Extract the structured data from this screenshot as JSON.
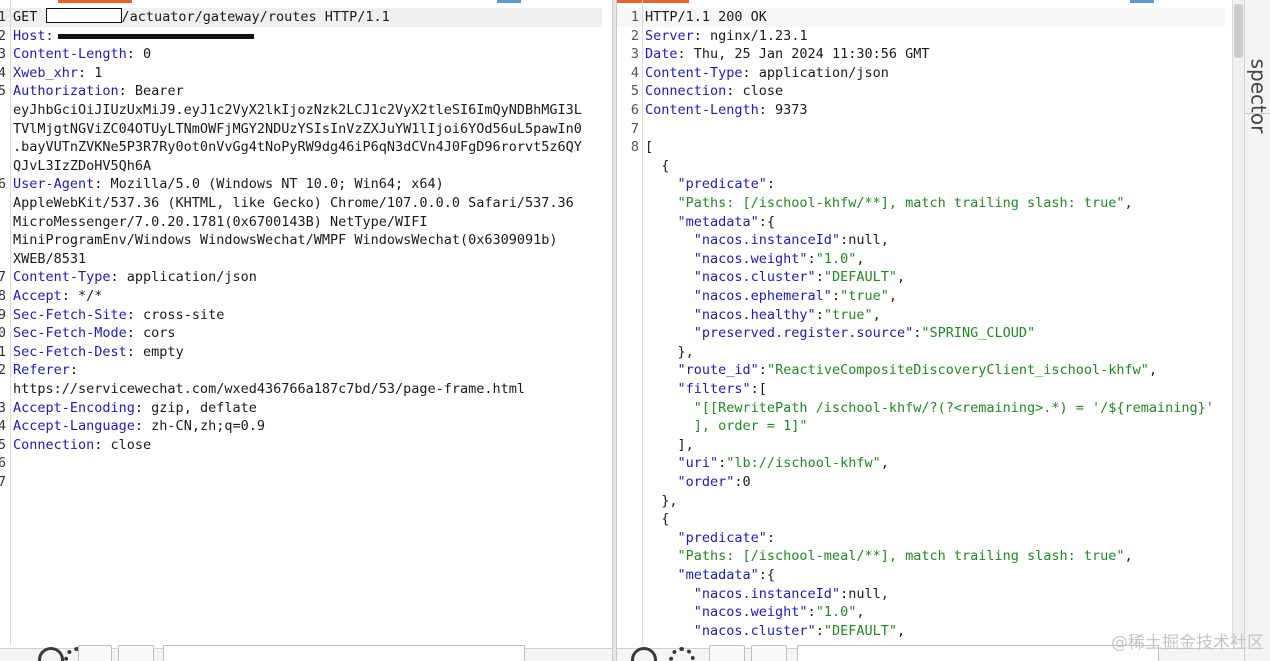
{
  "request": {
    "lines": [
      {
        "n": "1",
        "parts": [
          {
            "t": "GET ",
            "c": "plain"
          },
          {
            "redact": "box"
          },
          {
            "t": "/actuator/gateway/routes HTTP/1.1",
            "c": "plain"
          }
        ]
      },
      {
        "n": "2",
        "parts": [
          {
            "t": "Host:",
            "c": "hdr"
          },
          {
            "redact": "bar"
          }
        ]
      },
      {
        "n": "3",
        "parts": [
          {
            "t": "Content-Length",
            "c": "hdr"
          },
          {
            "t": ": 0",
            "c": "plain"
          }
        ]
      },
      {
        "n": "4",
        "parts": [
          {
            "t": "Xweb_xhr",
            "c": "hdr"
          },
          {
            "t": ": 1",
            "c": "plain"
          }
        ]
      },
      {
        "n": "5",
        "parts": [
          {
            "t": "Authorization",
            "c": "hdr"
          },
          {
            "t": ": Bearer",
            "c": "plain"
          }
        ]
      },
      {
        "n": "",
        "parts": [
          {
            "t": "eyJhbGciOiJIUzUxMiJ9.eyJ1c2VyX2lkIjozNzk2LCJ1c2VyX2tleSI6ImQyNDBhMGI3L",
            "c": "plain"
          }
        ]
      },
      {
        "n": "",
        "parts": [
          {
            "t": "TVlMjgtNGViZC04OTUyLTNmOWFjMGY2NDUzYSIsInVzZXJuYW1lIjoi6YOd56uL5pawIn0",
            "c": "plain"
          }
        ]
      },
      {
        "n": "",
        "parts": [
          {
            "t": ".bayVUTnZVKNe5P3R7Ry0ot0nVvGg4tNoPyRW9dg46iP6qN3dCVn4J0FgD96rorvt5z6QY",
            "c": "plain"
          }
        ]
      },
      {
        "n": "",
        "parts": [
          {
            "t": "QJvL3IzZDoHV5Qh6A",
            "c": "plain"
          }
        ]
      },
      {
        "n": "6",
        "parts": [
          {
            "t": "User-Agent",
            "c": "hdr"
          },
          {
            "t": ": Mozilla/5.0 (Windows NT 10.0; Win64; x64)",
            "c": "plain"
          }
        ]
      },
      {
        "n": "",
        "parts": [
          {
            "t": "AppleWebKit/537.36 (KHTML, like Gecko) Chrome/107.0.0.0 Safari/537.36",
            "c": "plain"
          }
        ]
      },
      {
        "n": "",
        "parts": [
          {
            "t": "MicroMessenger/7.0.20.1781(0x6700143B) NetType/WIFI",
            "c": "plain"
          }
        ]
      },
      {
        "n": "",
        "parts": [
          {
            "t": "MiniProgramEnv/Windows WindowsWechat/WMPF WindowsWechat(0x6309091b)",
            "c": "plain"
          }
        ]
      },
      {
        "n": "",
        "parts": [
          {
            "t": "XWEB/8531",
            "c": "plain"
          }
        ]
      },
      {
        "n": "7",
        "parts": [
          {
            "t": "Content-Type",
            "c": "hdr"
          },
          {
            "t": ": application/json",
            "c": "plain"
          }
        ]
      },
      {
        "n": "8",
        "parts": [
          {
            "t": "Accept",
            "c": "hdr"
          },
          {
            "t": ": */*",
            "c": "plain"
          }
        ]
      },
      {
        "n": "9",
        "parts": [
          {
            "t": "Sec-Fetch-Site",
            "c": "hdr"
          },
          {
            "t": ": cross-site",
            "c": "plain"
          }
        ]
      },
      {
        "n": "0",
        "parts": [
          {
            "t": "Sec-Fetch-Mode",
            "c": "hdr"
          },
          {
            "t": ": cors",
            "c": "plain"
          }
        ]
      },
      {
        "n": "1",
        "parts": [
          {
            "t": "Sec-Fetch-Dest",
            "c": "hdr"
          },
          {
            "t": ": empty",
            "c": "plain"
          }
        ]
      },
      {
        "n": "2",
        "parts": [
          {
            "t": "Referer",
            "c": "hdr"
          },
          {
            "t": ":",
            "c": "plain"
          }
        ]
      },
      {
        "n": "",
        "parts": [
          {
            "t": "https://servicewechat.com/wxed436766a187c7bd/53/page-frame.html",
            "c": "plain"
          }
        ]
      },
      {
        "n": "3",
        "parts": [
          {
            "t": "Accept-Encoding",
            "c": "hdr"
          },
          {
            "t": ": gzip, deflate",
            "c": "plain"
          }
        ]
      },
      {
        "n": "4",
        "parts": [
          {
            "t": "Accept-Language",
            "c": "hdr"
          },
          {
            "t": ": zh-CN,zh;q=0.9",
            "c": "plain"
          }
        ]
      },
      {
        "n": "5",
        "parts": [
          {
            "t": "Connection",
            "c": "hdr"
          },
          {
            "t": ": close",
            "c": "plain"
          }
        ]
      },
      {
        "n": "6",
        "parts": []
      },
      {
        "n": "7",
        "parts": []
      }
    ]
  },
  "response": {
    "lines": [
      {
        "n": "1",
        "parts": [
          {
            "t": "HTTP/1.1 200 OK",
            "c": "plain"
          }
        ]
      },
      {
        "n": "2",
        "parts": [
          {
            "t": "Server",
            "c": "hdr"
          },
          {
            "t": ": nginx/1.23.1",
            "c": "plain"
          }
        ]
      },
      {
        "n": "3",
        "parts": [
          {
            "t": "Date",
            "c": "hdr"
          },
          {
            "t": ": Thu, 25 Jan 2024 11:30:56 GMT",
            "c": "plain"
          }
        ]
      },
      {
        "n": "4",
        "parts": [
          {
            "t": "Content-Type",
            "c": "hdr"
          },
          {
            "t": ": application/json",
            "c": "plain"
          }
        ]
      },
      {
        "n": "5",
        "parts": [
          {
            "t": "Connection",
            "c": "hdr"
          },
          {
            "t": ": close",
            "c": "plain"
          }
        ]
      },
      {
        "n": "6",
        "parts": [
          {
            "t": "Content-Length",
            "c": "hdr"
          },
          {
            "t": ": 9373",
            "c": "plain"
          }
        ]
      },
      {
        "n": "7",
        "parts": []
      },
      {
        "n": "8",
        "parts": [
          {
            "t": "[",
            "c": "plain"
          }
        ]
      },
      {
        "n": "",
        "parts": [
          {
            "t": "  {",
            "c": "plain"
          }
        ]
      },
      {
        "n": "",
        "parts": [
          {
            "t": "    \"predicate\"",
            "c": "hdr"
          },
          {
            "t": ":",
            "c": "plain"
          }
        ]
      },
      {
        "n": "",
        "parts": [
          {
            "t": "    \"Paths: [/ischool-khfw/**], match trailing slash: true\"",
            "c": "str"
          },
          {
            "t": ",",
            "c": "plain"
          }
        ]
      },
      {
        "n": "",
        "parts": [
          {
            "t": "    \"metadata\"",
            "c": "hdr"
          },
          {
            "t": ":{",
            "c": "plain"
          }
        ]
      },
      {
        "n": "",
        "parts": [
          {
            "t": "      \"nacos.instanceId\"",
            "c": "hdr"
          },
          {
            "t": ":null,",
            "c": "plain"
          }
        ]
      },
      {
        "n": "",
        "parts": [
          {
            "t": "      \"nacos.weight\"",
            "c": "hdr"
          },
          {
            "t": ":",
            "c": "plain"
          },
          {
            "t": "\"1.0\"",
            "c": "str"
          },
          {
            "t": ",",
            "c": "plain"
          }
        ]
      },
      {
        "n": "",
        "parts": [
          {
            "t": "      \"nacos.cluster\"",
            "c": "hdr"
          },
          {
            "t": ":",
            "c": "plain"
          },
          {
            "t": "\"DEFAULT\"",
            "c": "str"
          },
          {
            "t": ",",
            "c": "plain"
          }
        ]
      },
      {
        "n": "",
        "parts": [
          {
            "t": "      \"nacos.ephemeral\"",
            "c": "hdr"
          },
          {
            "t": ":",
            "c": "plain"
          },
          {
            "t": "\"true\"",
            "c": "str"
          },
          {
            "t": ",",
            "c": "plain"
          }
        ]
      },
      {
        "n": "",
        "parts": [
          {
            "t": "      \"nacos.healthy\"",
            "c": "hdr"
          },
          {
            "t": ":",
            "c": "plain"
          },
          {
            "t": "\"true\"",
            "c": "str"
          },
          {
            "t": ",",
            "c": "plain"
          }
        ]
      },
      {
        "n": "",
        "parts": [
          {
            "t": "      \"preserved.register.source\"",
            "c": "hdr"
          },
          {
            "t": ":",
            "c": "plain"
          },
          {
            "t": "\"SPRING_CLOUD\"",
            "c": "str"
          }
        ]
      },
      {
        "n": "",
        "parts": [
          {
            "t": "    },",
            "c": "plain"
          }
        ]
      },
      {
        "n": "",
        "parts": [
          {
            "t": "    \"route_id\"",
            "c": "hdr"
          },
          {
            "t": ":",
            "c": "plain"
          },
          {
            "t": "\"ReactiveCompositeDiscoveryClient_ischool-khfw\"",
            "c": "str"
          },
          {
            "t": ",",
            "c": "plain"
          }
        ]
      },
      {
        "n": "",
        "parts": [
          {
            "t": "    \"filters\"",
            "c": "hdr"
          },
          {
            "t": ":[",
            "c": "plain"
          }
        ]
      },
      {
        "n": "",
        "parts": [
          {
            "t": "      \"[[RewritePath /ischool-khfw/?(?<remaining>.*) = '/${remaining}'",
            "c": "str"
          }
        ]
      },
      {
        "n": "",
        "parts": [
          {
            "t": "      ], order = 1]\"",
            "c": "str"
          }
        ]
      },
      {
        "n": "",
        "parts": [
          {
            "t": "    ],",
            "c": "plain"
          }
        ]
      },
      {
        "n": "",
        "parts": [
          {
            "t": "    \"uri\"",
            "c": "hdr"
          },
          {
            "t": ":",
            "c": "plain"
          },
          {
            "t": "\"lb://ischool-khfw\"",
            "c": "str"
          },
          {
            "t": ",",
            "c": "plain"
          }
        ]
      },
      {
        "n": "",
        "parts": [
          {
            "t": "    \"order\"",
            "c": "hdr"
          },
          {
            "t": ":0",
            "c": "plain"
          }
        ]
      },
      {
        "n": "",
        "parts": [
          {
            "t": "  },",
            "c": "plain"
          }
        ]
      },
      {
        "n": "",
        "parts": [
          {
            "t": "  {",
            "c": "plain"
          }
        ]
      },
      {
        "n": "",
        "parts": [
          {
            "t": "    \"predicate\"",
            "c": "hdr"
          },
          {
            "t": ":",
            "c": "plain"
          }
        ]
      },
      {
        "n": "",
        "parts": [
          {
            "t": "    \"Paths: [/ischool-meal/**], match trailing slash: true\"",
            "c": "str"
          },
          {
            "t": ",",
            "c": "plain"
          }
        ]
      },
      {
        "n": "",
        "parts": [
          {
            "t": "    \"metadata\"",
            "c": "hdr"
          },
          {
            "t": ":{",
            "c": "plain"
          }
        ]
      },
      {
        "n": "",
        "parts": [
          {
            "t": "      \"nacos.instanceId\"",
            "c": "hdr"
          },
          {
            "t": ":null,",
            "c": "plain"
          }
        ]
      },
      {
        "n": "",
        "parts": [
          {
            "t": "      \"nacos.weight\"",
            "c": "hdr"
          },
          {
            "t": ":",
            "c": "plain"
          },
          {
            "t": "\"1.0\"",
            "c": "str"
          },
          {
            "t": ",",
            "c": "plain"
          }
        ]
      },
      {
        "n": "",
        "parts": [
          {
            "t": "      \"nacos.cluster\"",
            "c": "hdr"
          },
          {
            "t": ":",
            "c": "plain"
          },
          {
            "t": "\"DEFAULT\"",
            "c": "str"
          },
          {
            "t": ",",
            "c": "plain"
          }
        ]
      }
    ]
  },
  "side_tab": {
    "label": "spector"
  },
  "watermark": {
    "text": "@稀土掘金技术社区"
  },
  "icons": {
    "left_help": "help-icon",
    "left_settings": "gear-icon",
    "right_help": "help-icon",
    "right_settings": "gear-icon"
  }
}
